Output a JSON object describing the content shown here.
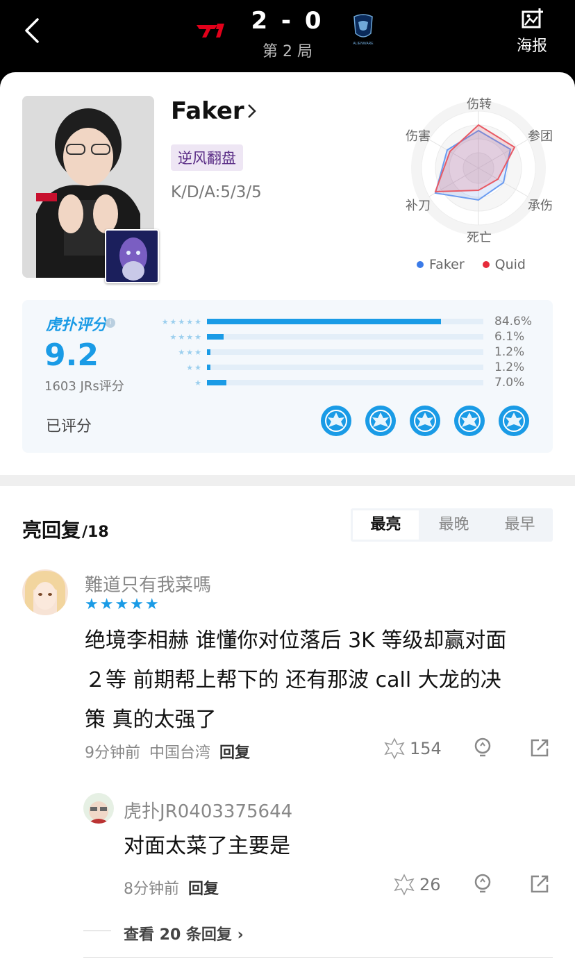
{
  "header": {
    "score": "2 - 0",
    "game_no": "第 2 局",
    "poster_label": "海报",
    "team_left_logo": "T1",
    "team_right_logo": "ALIENWARE"
  },
  "player": {
    "name": "Faker",
    "tag": "逆风翻盘",
    "kda": "K/D/A:5/3/5"
  },
  "radar": {
    "labels": [
      "伤转",
      "参团",
      "承伤",
      "死亡",
      "补刀",
      "伤害"
    ],
    "legend": [
      {
        "name": "Faker",
        "color": "#3b7be8"
      },
      {
        "name": "Quid",
        "color": "#e62b3a"
      }
    ]
  },
  "rating": {
    "logo": "虎扑评分",
    "score": "9.2",
    "count": "1603 JRs评分",
    "rated_label": "已评分",
    "rows": [
      {
        "stars": "★★★★★",
        "pct": "84.6%",
        "fraction": 0.846
      },
      {
        "stars": "★★★★",
        "pct": "6.1%",
        "fraction": 0.061
      },
      {
        "stars": "★★★",
        "pct": "1.2%",
        "fraction": 0.012
      },
      {
        "stars": "★★",
        "pct": "1.2%",
        "fraction": 0.012
      },
      {
        "stars": "★",
        "pct": "7.0%",
        "fraction": 0.07
      }
    ]
  },
  "comments_section": {
    "title": "亮回复",
    "count": "/18",
    "tabs": [
      "最亮",
      "最晚",
      "最早"
    ],
    "active_tab": 0,
    "comments": [
      {
        "user": "難道只有我菜嗎",
        "stars": "★★★★★",
        "text_lines": [
          "绝境李相赫 谁懂你对位落后 3K 等级却赢对面",
          "２等 前期帮上帮下的 还有那波 call 大龙的决",
          "策 真的太强了"
        ],
        "time": "9分钟前",
        "location": "中国台湾",
        "reply_label": "回复",
        "likes": "154"
      },
      {
        "user": "虎扑JR0403375644",
        "text": "对面太菜了主要是",
        "time": "8分钟前",
        "reply_label": "回复",
        "likes": "26"
      }
    ],
    "view_more": "查看 20 条回复"
  }
}
